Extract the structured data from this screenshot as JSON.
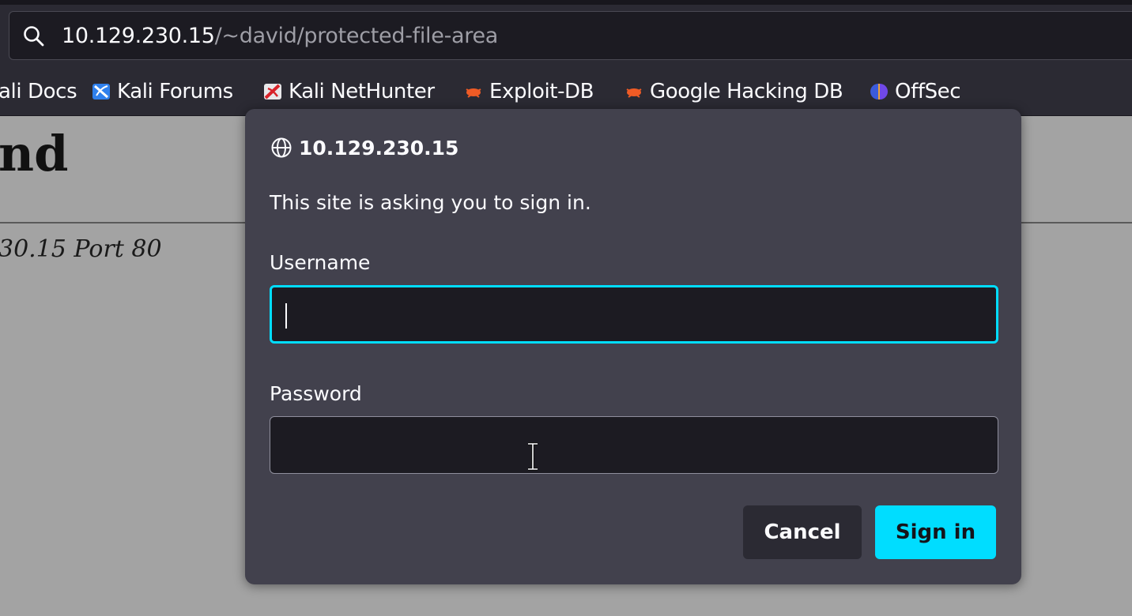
{
  "browser": {
    "url": {
      "host": "10.129.230.15",
      "path": "/~david/protected-file-area"
    },
    "bookmarks": [
      {
        "label": "ali Docs",
        "icon": "kali-docs-icon"
      },
      {
        "label": "Kali Forums",
        "icon": "kali-forums-icon"
      },
      {
        "label": "Kali NetHunter",
        "icon": "kali-nethunter-icon"
      },
      {
        "label": "Exploit-DB",
        "icon": "exploit-db-icon"
      },
      {
        "label": "Google Hacking DB",
        "icon": "ghdb-icon"
      },
      {
        "label": "OffSec",
        "icon": "offsec-icon"
      }
    ]
  },
  "page": {
    "heading_fragment": "nd",
    "address_fragment": "30.15 Port 80"
  },
  "dialog": {
    "origin": "10.129.230.15",
    "message": "This site is asking you to sign in.",
    "username_label": "Username",
    "username_value": "",
    "password_label": "Password",
    "password_value": "",
    "cancel_label": "Cancel",
    "signin_label": "Sign in"
  },
  "colors": {
    "accent": "#00ddff",
    "dialog_bg": "#42414d",
    "toolbar_bg": "#2b2a33",
    "field_bg": "#1c1b22"
  }
}
